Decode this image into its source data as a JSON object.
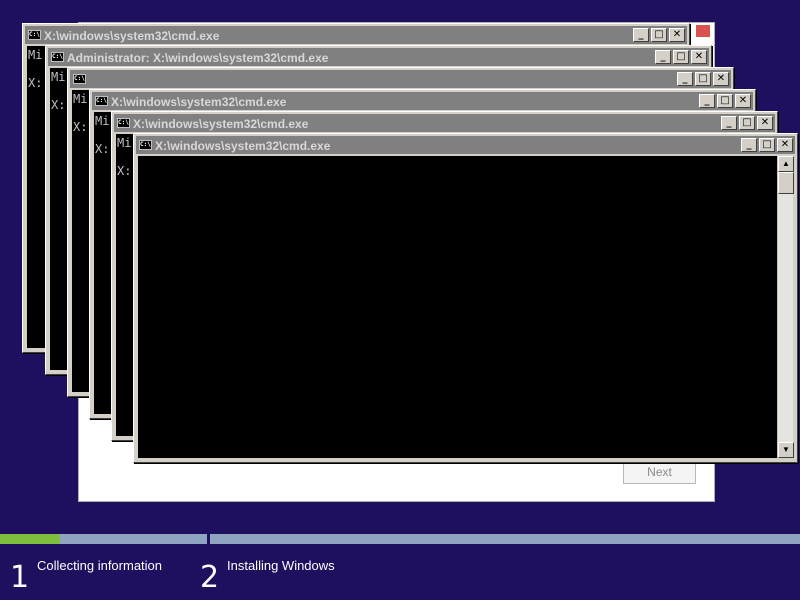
{
  "setup": {
    "next_label": "Next"
  },
  "windows": [
    {
      "title": "X:\\windows\\system32\\cmd.exe",
      "lines": "Mi\n\nX:"
    },
    {
      "title": "Administrator: X:\\windows\\system32\\cmd.exe",
      "lines": "Mi\n\nX:"
    },
    {
      "title": "",
      "lines": "Mi\n\nX:"
    },
    {
      "title": "X:\\windows\\system32\\cmd.exe",
      "lines": "Mi\n\nX:"
    },
    {
      "title": "X:\\windows\\system32\\cmd.exe",
      "lines": "Mi\n\nX:"
    },
    {
      "title": "X:\\windows\\system32\\cmd.exe",
      "lines": ""
    }
  ],
  "title_icon_text": "C:\\",
  "window_buttons": {
    "minimize": "_",
    "maximize": "□",
    "close": "✕"
  },
  "scroll_arrows": {
    "up": "▲",
    "down": "▼"
  },
  "progress": {
    "step1_fraction": 0.29,
    "steps": [
      {
        "number": "1",
        "label": "Collecting information"
      },
      {
        "number": "2",
        "label": "Installing Windows"
      }
    ]
  },
  "colors": {
    "background": "#1f0f5f",
    "progress_fill": "#7fbf3f",
    "progress_track": "#8fa4c0",
    "spinner": "#3fc9d6"
  }
}
